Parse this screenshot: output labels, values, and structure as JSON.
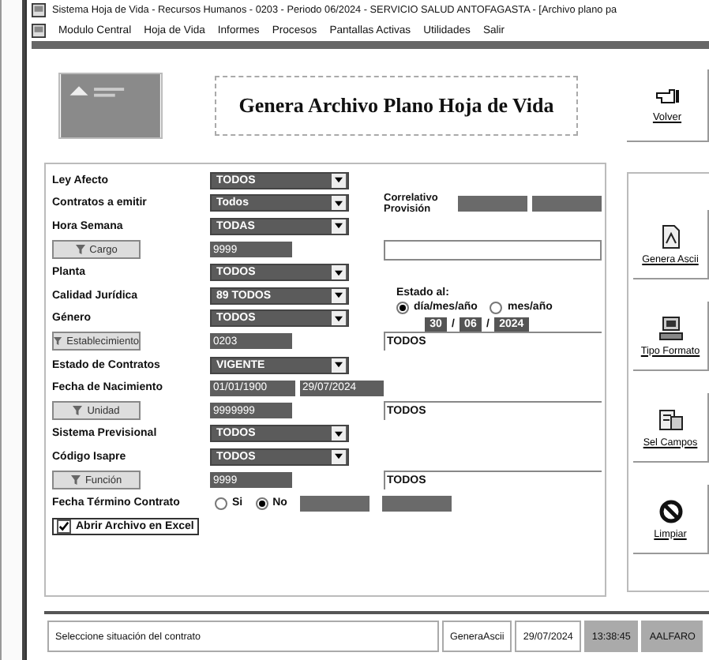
{
  "window": {
    "title": "Sistema Hoja de Vida - Recursos Humanos - 0203 - Periodo 06/2024 - SERVICIO SALUD ANTOFAGASTA - [Archivo plano pa"
  },
  "menu": [
    "Modulo Central",
    "Hoja de Vida",
    "Informes",
    "Procesos",
    "Pantallas Activas",
    "Utilidades",
    "Salir"
  ],
  "header": {
    "title": "Genera Archivo Plano Hoja de Vida",
    "back_button": "Volver"
  },
  "form": {
    "rows": [
      {
        "kind": "combo",
        "label": "Ley Afecto",
        "value": "TODOS"
      },
      {
        "kind": "combo",
        "label": "Contratos a emitir",
        "value": "Todos",
        "extra_label": "Correlativo Provisión"
      },
      {
        "kind": "combo",
        "label": "Hora Semana",
        "value": "TODAS"
      },
      {
        "kind": "lookup",
        "button": "Cargo",
        "value": "9999"
      },
      {
        "kind": "combo",
        "label": "Planta",
        "value": "TODOS"
      },
      {
        "kind": "combo",
        "label": "Calidad Jurídica",
        "value": "89 TODOS",
        "estado": {
          "label": "Estado al:",
          "options": [
            {
              "label": "día/mes/año",
              "selected": true
            },
            {
              "label": "mes/año",
              "selected": false
            }
          ],
          "date": [
            "30",
            "/",
            "06",
            "/",
            "2024"
          ]
        }
      },
      {
        "kind": "combo",
        "label": "Género",
        "value": "TODOS"
      },
      {
        "kind": "lookup",
        "button": "Establecimiento",
        "value": "0203",
        "description": "TODOS"
      },
      {
        "kind": "combo",
        "label": "Estado de Contratos",
        "value": "VIGENTE"
      },
      {
        "kind": "dates",
        "label": "Fecha de Nacimiento",
        "from": "01/01/1900",
        "to": "29/07/2024"
      },
      {
        "kind": "lookup",
        "button": "Unidad",
        "value": "9999999",
        "description": "TODOS"
      },
      {
        "kind": "combo",
        "label": "Sistema Previsional",
        "value": "TODOS"
      },
      {
        "kind": "combo",
        "label": "Código Isapre",
        "value": "TODOS"
      },
      {
        "kind": "lookup",
        "button": "Función",
        "value": "9999",
        "description": "TODOS"
      },
      {
        "kind": "radio",
        "label": "Fecha Término Contrato",
        "options": [
          {
            "label": "Si",
            "selected": false
          },
          {
            "label": "No",
            "selected": true
          }
        ]
      },
      {
        "kind": "check",
        "label": "Abrir Archivo en Excel",
        "checked": true
      }
    ]
  },
  "side_buttons": [
    {
      "kind": "ascii",
      "label": "Genera Ascii"
    },
    {
      "kind": "format",
      "label": "Tipo Formato"
    },
    {
      "kind": "fields",
      "label": "Sel Campos"
    },
    {
      "kind": "clear",
      "label": "Limpiar"
    }
  ],
  "status_bar": [
    "Seleccione situación del contrato",
    "GeneraAscii",
    "29/07/2024",
    "13:38:45",
    "AALFARO"
  ]
}
